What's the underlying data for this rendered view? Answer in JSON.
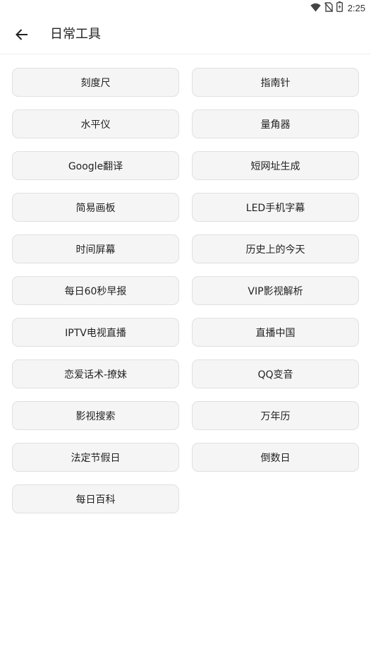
{
  "status_bar": {
    "time": "2:25",
    "icons": [
      "wifi-icon",
      "no-sim-icon",
      "battery-icon"
    ]
  },
  "toolbar": {
    "back_icon": "arrow-left-icon",
    "title": "日常工具"
  },
  "colors": {
    "button_background": "#f5f5f5",
    "button_border": "#e0e0e0",
    "text": "#222222"
  },
  "tools": [
    "刻度尺",
    "指南针",
    "水平仪",
    "量角器",
    "Google翻译",
    "短网址生成",
    "简易画板",
    "LED手机字幕",
    "时间屏幕",
    "历史上的今天",
    "每日60秒早报",
    "VIP影视解析",
    "IPTV电视直播",
    "直播中国",
    "恋爱话术-撩妹",
    "QQ变音",
    "影视搜索",
    "万年历",
    "法定节假日",
    "倒数日",
    "每日百科"
  ]
}
